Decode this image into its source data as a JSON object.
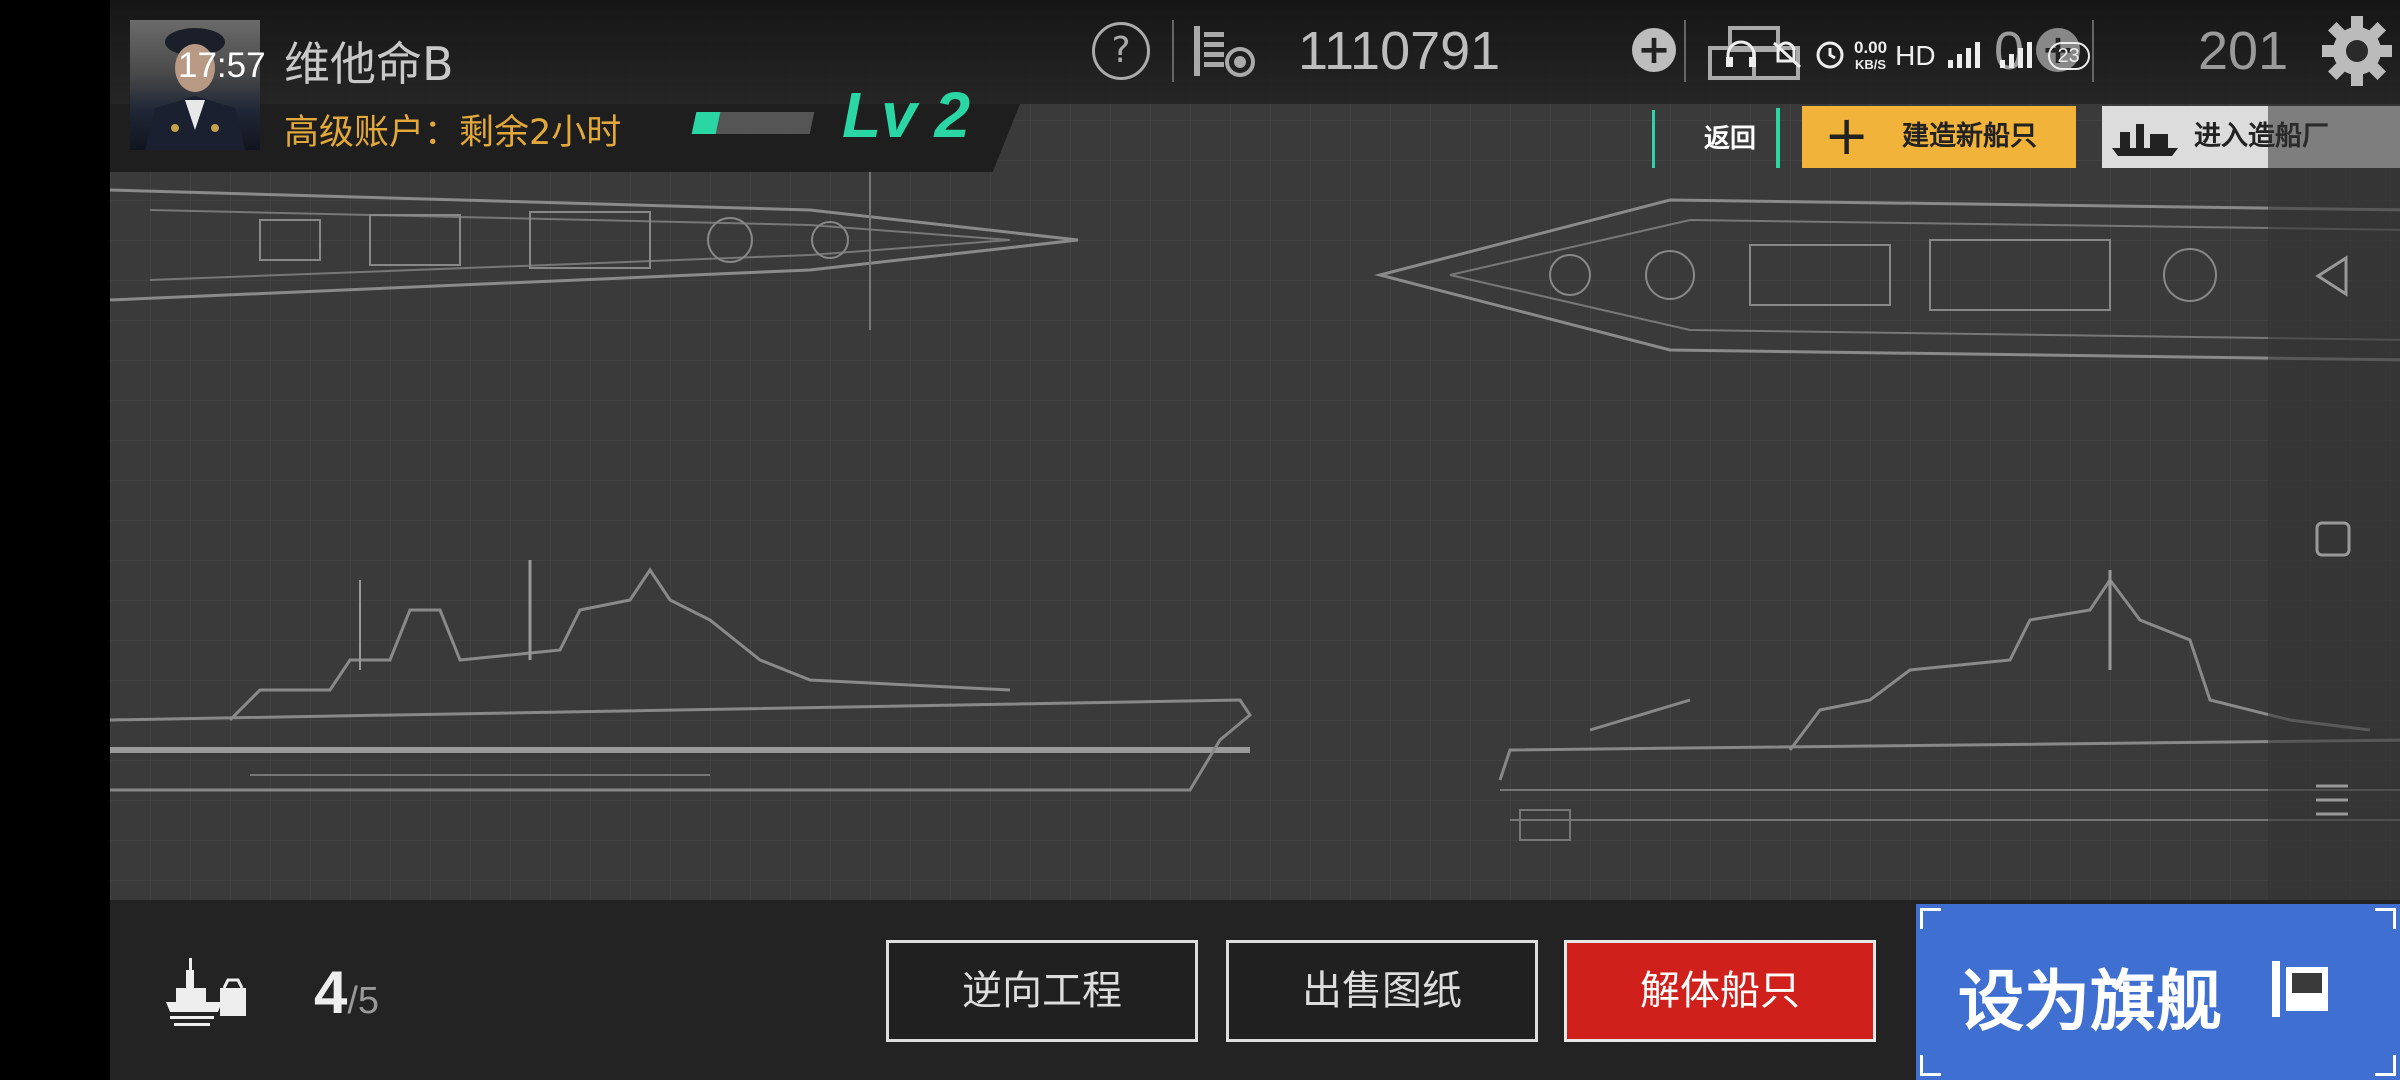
{
  "status_bar": {
    "time": "17:57",
    "net_speed_value": "0.00",
    "net_speed_unit": "KB/S",
    "hd_label": "HD",
    "battery": "23"
  },
  "player": {
    "name": "维他命B",
    "account_status": "高级账户：剩余2小时",
    "level": "Lv 2",
    "xp_progress_fraction": 0.2
  },
  "resources": {
    "credits": "1110791",
    "resource2": "0",
    "resource3": "201"
  },
  "actions": {
    "back": "返回",
    "build_new": "建造新船只",
    "enter_shipyard": "进入造船厂"
  },
  "bottom": {
    "fleet_current": "4",
    "fleet_max": "/5",
    "reverse_engineer": "逆向工程",
    "sell_blueprint": "出售图纸",
    "scrap_ship": "解体船只",
    "set_flagship": "设为旗舰"
  },
  "icons": {
    "help": "help-icon",
    "settings": "gear-icon",
    "add": "plus-icon",
    "fleet": "fleet-icon",
    "crate": "crate-icon",
    "resource": "resource-icon"
  },
  "colors": {
    "accent_green": "#2ad6a4",
    "gold": "#f2b33a",
    "red": "#d0201c",
    "blue": "#3f6fd1"
  }
}
